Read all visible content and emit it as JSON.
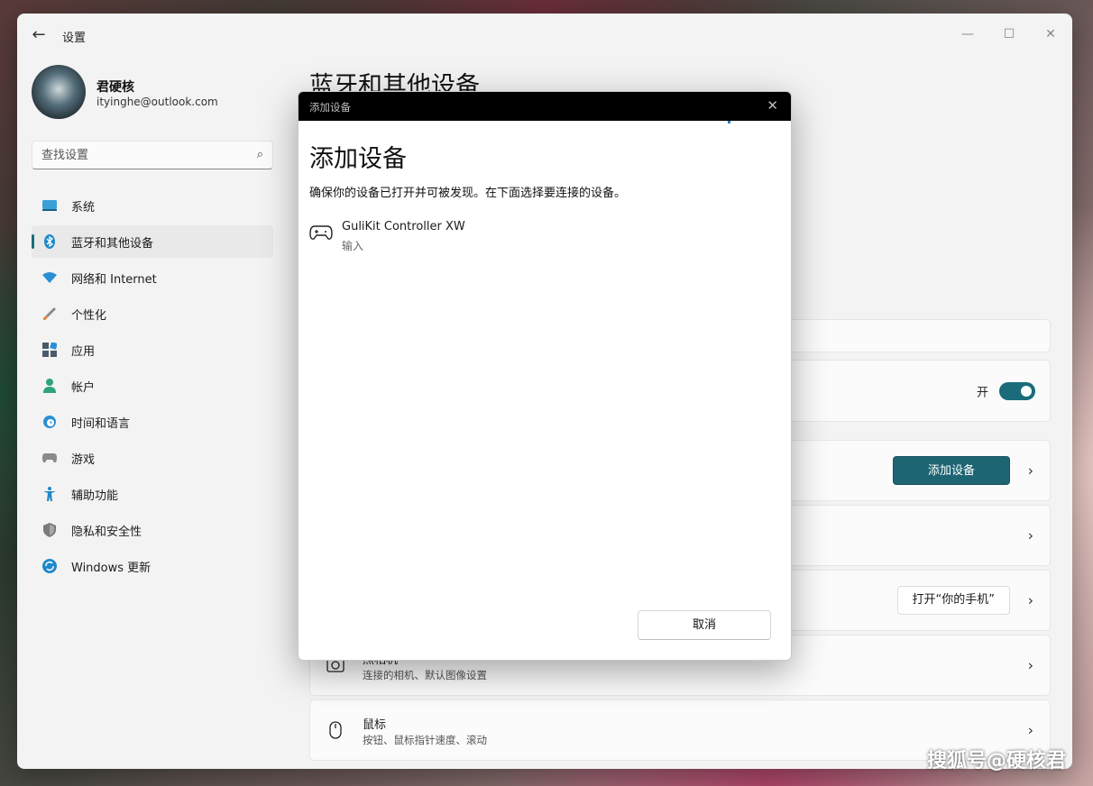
{
  "window": {
    "app_title": "设置",
    "controls": {
      "minimize": "—",
      "maximize": "☐",
      "close": "✕"
    }
  },
  "profile": {
    "name": "君硬核",
    "email": "ityinghe@outlook.com"
  },
  "search": {
    "placeholder": "查找设置"
  },
  "nav": {
    "items": [
      {
        "label": "系统",
        "icon": "monitor-icon",
        "color": "#1e88c8"
      },
      {
        "label": "蓝牙和其他设备",
        "icon": "bluetooth-icon",
        "color": "#1e88c8",
        "active": true
      },
      {
        "label": "网络和 Internet",
        "icon": "wifi-icon",
        "color": "#1e88c8"
      },
      {
        "label": "个性化",
        "icon": "brush-icon",
        "color": "#e0803a"
      },
      {
        "label": "应用",
        "icon": "apps-icon",
        "color": "#4a5a6a"
      },
      {
        "label": "帐户",
        "icon": "person-icon",
        "color": "#2fa37a"
      },
      {
        "label": "时间和语言",
        "icon": "globe-clock-icon",
        "color": "#1e88c8"
      },
      {
        "label": "游戏",
        "icon": "gamepad-icon",
        "color": "#7a7a7a"
      },
      {
        "label": "辅助功能",
        "icon": "accessibility-icon",
        "color": "#1e88c8"
      },
      {
        "label": "隐私和安全性",
        "icon": "shield-icon",
        "color": "#7a7a7a"
      },
      {
        "label": "Windows 更新",
        "icon": "sync-icon",
        "color": "#1e88c8"
      }
    ]
  },
  "main": {
    "page_title": "蓝牙和其他设备",
    "bluetooth_toggle_label": "开",
    "add_device_button": "添加设备",
    "phone_button": "打开“你的手机”",
    "camera": {
      "title": "照相机",
      "desc": "连接的相机、默认图像设置"
    },
    "mouse": {
      "title": "鼠标",
      "desc": "按钮、鼠标指针速度、滚动"
    }
  },
  "dialog": {
    "caption": "添加设备",
    "heading": "添加设备",
    "instruction": "确保你的设备已打开并可被发现。在下面选择要连接的设备。",
    "devices": [
      {
        "name": "GuliKit Controller XW",
        "type": "输入",
        "icon": "gamepad-icon"
      }
    ],
    "cancel_button": "取消"
  },
  "watermark": "搜狐号@硬核君",
  "colors": {
    "accent": "#1e6573",
    "dialog_titlebar": "#000000"
  }
}
